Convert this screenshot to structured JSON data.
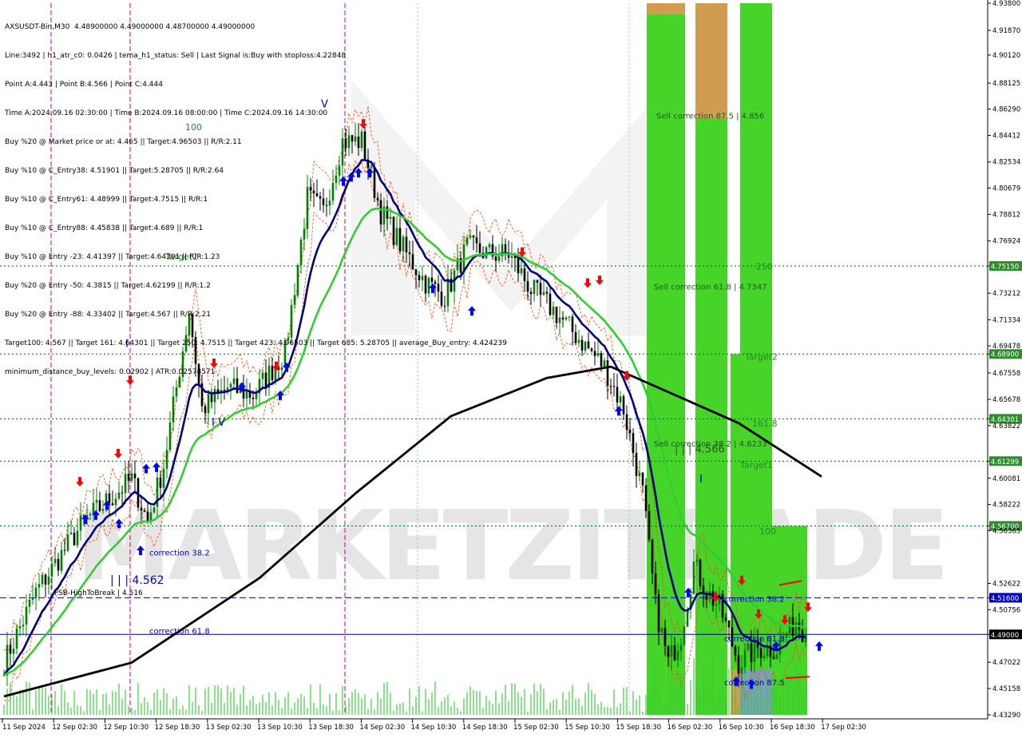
{
  "info_lines": [
    "AXSUSDT-Bin,M30  4.48900000 4.49000000 4.48700000 4.49000000",
    "Line:3492 | h1_atr_c0: 0.0426 | tema_h1_status: Sell | Last Signal is:Buy with stoploss:4.22848",
    "Point A:4.443 | Point B:4.566 | Point C:4.444",
    "Time A:2024.09.16 02:30:00 | Time B:2024.09.16 08:00:00 | Time C:2024.09.16 14:30:00",
    "Buy %20 @ Market price or at: 4.465 || Target:4.96503 || R/R:2.11",
    "Buy %10 @ C_Entry38: 4.51901 || Target:5.28705 || R/R:2.64",
    "Buy %10 @ C_Entry61: 4.48999 || Target:4.7515 || R/R:1",
    "Buy %10 @ C_Entry88: 4.45838 || Target:4.689 || R/R:1",
    "Buy %10 @ Entry -23: 4.41397 || Target:4.64301 || R/R:1.23",
    "Buy %20 @ Entry -50: 4.3815 || Target:4.62199 || R/R:1.2",
    "Buy %20 @ Entry -88: 4.33402 || Target:4.567 || R/R:2.21",
    "Target100: 4.567 || Target 161: 4.64301 || Target 250: 4.7515 || Target 423: 4.96503 || Target 685: 5.28705 || average_Buy_entry: 4.424239",
    "minimum_distance_buy_levels: 0.02902 | ATR:0.02578571"
  ],
  "watermark": "MARKETZITRADE",
  "colors": {
    "bull": "#008000",
    "bear": "#000000",
    "ema_fast": "#000080",
    "ema_mid": "#33cc33",
    "ema_slow": "#000000",
    "level": "#006400",
    "level_label_bg": "#2e8b2e",
    "fsh": "#0000cc",
    "current": "#000080",
    "fib_green": "#3cd21e",
    "fib_orange": "#d89a52",
    "fib_blue": "#7f9cc8",
    "buy_arrow": "#0000ff",
    "sell_arrow": "#ff0000",
    "vline": "#cc0077",
    "envelope": "#ff4500"
  },
  "chart_data": {
    "type": "candlestick",
    "symbol": "AXSUSDT-Bin",
    "timeframe": "M30",
    "ylim": [
      4.4329,
      4.938
    ],
    "y_ticks": [
      "4.93800",
      "4.91870",
      "4.90120",
      "4.88125",
      "4.86290",
      "4.84412",
      "4.82534",
      "4.80679",
      "4.78812",
      "4.76924",
      "4.75150",
      "4.73212",
      "4.71334",
      "4.69478",
      "4.68900",
      "4.67558",
      "4.65678",
      "4.64301",
      "4.63822",
      "4.61299",
      "4.60081",
      "4.58222",
      "4.56700",
      "4.56365",
      "4.52622",
      "4.51600",
      "4.50756",
      "4.49000",
      "4.47022",
      "4.45158",
      "4.43290"
    ],
    "x_labels": [
      "11 Sep 2024",
      "12 Sep 02:30",
      "12 Sep 10:30",
      "12 Sep 18:30",
      "13 Sep 02:30",
      "13 Sep 10:30",
      "13 Sep 18:30",
      "14 Sep 02:30",
      "14 Sep 10:30",
      "14 Sep 18:30",
      "15 Sep 02:30",
      "15 Sep 10:30",
      "15 Sep 18:30",
      "16 Sep 02:30",
      "16 Sep 10:30",
      "16 Sep 18:30",
      "17 Sep 02:30"
    ],
    "levels": [
      {
        "name": "Target 250",
        "price": 4.7515,
        "label": "4.75150",
        "style": "dotted"
      },
      {
        "name": "Target 2",
        "price": 4.689,
        "label": "4.68900",
        "style": "dotted"
      },
      {
        "name": "Target 161.8",
        "price": 4.64301,
        "label": "4.64301",
        "style": "dotted"
      },
      {
        "name": "Target 1",
        "price": 4.61299,
        "label": "4.61299",
        "style": "dotted"
      },
      {
        "name": "Target 100",
        "price": 4.567,
        "label": "4.56700",
        "style": "dotted"
      },
      {
        "name": "FSB-HighToBreak",
        "price": 4.516,
        "label": "4.51600",
        "style": "dashed"
      },
      {
        "name": "Current",
        "price": 4.49,
        "label": "4.49000",
        "style": "solid"
      }
    ],
    "annotations": [
      {
        "text": "Target1",
        "price": 4.756,
        "x_label": "12 Sep 10:30"
      },
      {
        "text": "100",
        "price": 4.848,
        "x_label": "12 Sep 10:30"
      },
      {
        "text": "correction 38.2",
        "price": 4.546
      },
      {
        "text": "correction 61.8",
        "price": 4.4905
      },
      {
        "text": "| | | 4.562",
        "price": 4.526
      },
      {
        "text": "FSB-HighToBreak | 4.516",
        "price": 4.518
      },
      {
        "text": "Sell correction 87.5 | 4.856",
        "price": 4.856
      },
      {
        "text": "Sell correction 61.8 | 4.7347",
        "price": 4.7347
      },
      {
        "text": "Sell correction 38.2 | 4.6233",
        "price": 4.6233
      },
      {
        "text": "| | | 4.566",
        "price": 4.619
      },
      {
        "text": "250",
        "price": 4.749
      },
      {
        "text": "Target2",
        "price": 4.685
      },
      {
        "text": "161.8",
        "price": 4.6375
      },
      {
        "text": "Target1",
        "price": 4.608
      },
      {
        "text": "100",
        "price": 4.561
      },
      {
        "text": "correction 38.2",
        "price": 4.513
      },
      {
        "text": "correction 61.8",
        "price": 4.485
      },
      {
        "text": "correction 87.5",
        "price": 4.454
      },
      {
        "text": "V",
        "price": 4.864
      },
      {
        "text": "I",
        "price": 4.694
      },
      {
        "text": "I V",
        "price": 4.638
      },
      {
        "text": "I",
        "price": 4.598
      }
    ]
  }
}
